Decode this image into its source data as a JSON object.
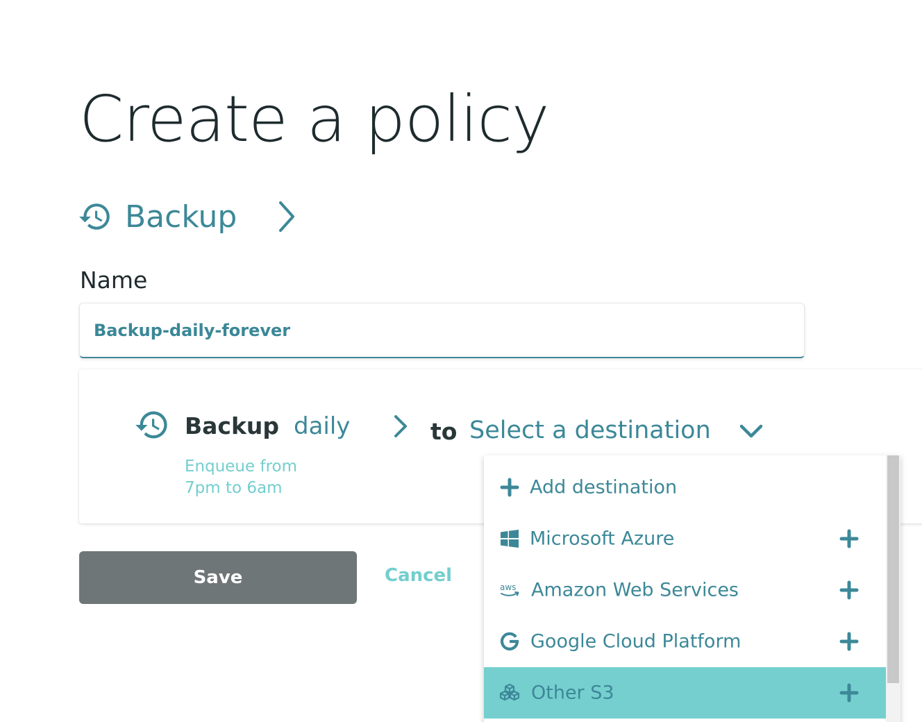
{
  "header": {
    "title": "Create a policy"
  },
  "breadcrumb": {
    "step": "Backup"
  },
  "form": {
    "name_label": "Name",
    "name_value": "Backup-daily-forever"
  },
  "rule": {
    "action": "Backup",
    "frequency": "daily",
    "schedule": "Enqueue from\n7pm to 6am",
    "connector": "to",
    "destination_placeholder": "Select a destination"
  },
  "actions": {
    "save_label": "Save",
    "cancel_label": "Cancel"
  },
  "dropdown": {
    "items": [
      {
        "label": "Add destination",
        "icon": "plus-icon"
      },
      {
        "label": "Microsoft Azure",
        "icon": "windows-logo-icon"
      },
      {
        "label": "Amazon Web Services",
        "icon": "aws-logo-icon"
      },
      {
        "label": "Google Cloud Platform",
        "icon": "google-logo-icon"
      },
      {
        "label": "Other S3",
        "icon": "s3-cubes-icon",
        "highlighted": true
      }
    ]
  },
  "colors": {
    "accent": "#3c8898",
    "light_accent": "#74cece",
    "highlight": "#76cfcf",
    "title_text": "#1e2b2e",
    "save_button": "#6f7678"
  }
}
